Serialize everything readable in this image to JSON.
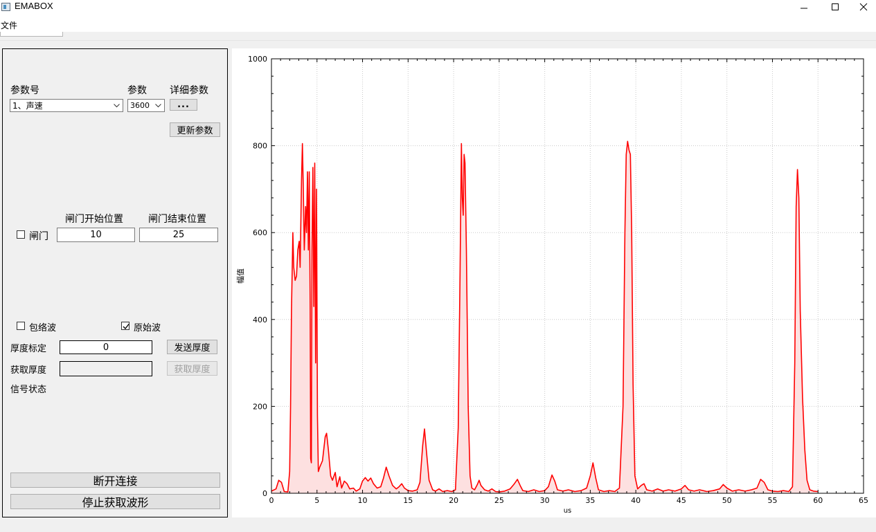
{
  "window": {
    "title": "EMABOX",
    "controls": [
      "minimize-icon",
      "maximize-icon",
      "close-icon"
    ]
  },
  "menu": {
    "file": "文件"
  },
  "params": {
    "param_no_label": "参数号",
    "param_label": "参数",
    "detail_label": "详细参数",
    "param_no_value": "1、声速",
    "param_value": "3600",
    "detail_button": "...",
    "update_button": "更新参数"
  },
  "gate": {
    "checkbox_label": "闸门",
    "checked": false,
    "start_label": "闸门开始位置",
    "end_label": "闸门结束位置",
    "start_value": "10",
    "end_value": "25"
  },
  "wave": {
    "envelope_label": "包络波",
    "envelope_checked": false,
    "raw_label": "原始波",
    "raw_checked": true
  },
  "thickness": {
    "calib_label": "厚度标定",
    "calib_value": "0",
    "send_button": "发送厚度",
    "get_label": "获取厚度",
    "get_value": "",
    "get_button": "获取厚度"
  },
  "signal": {
    "status_label": "信号状态"
  },
  "actions": {
    "disconnect": "断开连接",
    "stop_wave": "停止获取波形"
  },
  "chart_data": {
    "type": "area",
    "xlabel": "us",
    "ylabel": "幅值",
    "xlim": [
      0,
      65
    ],
    "ylim": [
      0,
      1000
    ],
    "x_ticks": [
      0,
      5,
      10,
      15,
      20,
      25,
      30,
      35,
      40,
      45,
      50,
      55,
      60,
      65
    ],
    "y_ticks": [
      0,
      200,
      400,
      600,
      800,
      1000
    ],
    "grid": true,
    "line_color": "#ff0000",
    "fill_color": "#fde0e0",
    "series": [
      {
        "points": [
          [
            0,
            5
          ],
          [
            0.5,
            10
          ],
          [
            0.8,
            30
          ],
          [
            1.1,
            25
          ],
          [
            1.4,
            4
          ],
          [
            1.8,
            3
          ],
          [
            2.0,
            50
          ],
          [
            2.1,
            200
          ],
          [
            2.2,
            420
          ],
          [
            2.35,
            600
          ],
          [
            2.45,
            520
          ],
          [
            2.6,
            490
          ],
          [
            2.75,
            500
          ],
          [
            2.9,
            560
          ],
          [
            3.05,
            580
          ],
          [
            3.15,
            520
          ],
          [
            3.3,
            720
          ],
          [
            3.4,
            805
          ],
          [
            3.5,
            700
          ],
          [
            3.6,
            560
          ],
          [
            3.75,
            660
          ],
          [
            3.85,
            600
          ],
          [
            3.95,
            740
          ],
          [
            4.05,
            560
          ],
          [
            4.15,
            740
          ],
          [
            4.25,
            430
          ],
          [
            4.3,
            80
          ],
          [
            4.38,
            70
          ],
          [
            4.45,
            560
          ],
          [
            4.55,
            750
          ],
          [
            4.65,
            430
          ],
          [
            4.75,
            760
          ],
          [
            4.85,
            300
          ],
          [
            4.95,
            700
          ],
          [
            5.05,
            180
          ],
          [
            5.15,
            50
          ],
          [
            5.3,
            60
          ],
          [
            5.6,
            75
          ],
          [
            5.9,
            130
          ],
          [
            6.05,
            138
          ],
          [
            6.25,
            100
          ],
          [
            6.5,
            40
          ],
          [
            6.7,
            30
          ],
          [
            7.0,
            48
          ],
          [
            7.2,
            15
          ],
          [
            7.5,
            38
          ],
          [
            7.7,
            12
          ],
          [
            8.0,
            28
          ],
          [
            8.3,
            22
          ],
          [
            8.6,
            10
          ],
          [
            9.0,
            12
          ],
          [
            9.3,
            5
          ],
          [
            9.7,
            10
          ],
          [
            10.0,
            28
          ],
          [
            10.3,
            36
          ],
          [
            10.6,
            28
          ],
          [
            10.9,
            35
          ],
          [
            11.2,
            22
          ],
          [
            11.6,
            12
          ],
          [
            12.0,
            15
          ],
          [
            12.3,
            35
          ],
          [
            12.6,
            60
          ],
          [
            12.9,
            40
          ],
          [
            13.3,
            18
          ],
          [
            13.7,
            10
          ],
          [
            14.0,
            15
          ],
          [
            14.3,
            22
          ],
          [
            14.6,
            12
          ],
          [
            15.0,
            6
          ],
          [
            15.5,
            5
          ],
          [
            16.0,
            8
          ],
          [
            16.3,
            25
          ],
          [
            16.6,
            110
          ],
          [
            16.8,
            148
          ],
          [
            17.0,
            100
          ],
          [
            17.3,
            30
          ],
          [
            17.7,
            8
          ],
          [
            18.0,
            5
          ],
          [
            18.4,
            10
          ],
          [
            18.8,
            4
          ],
          [
            19.3,
            6
          ],
          [
            19.8,
            4
          ],
          [
            20.2,
            8
          ],
          [
            20.5,
            150
          ],
          [
            20.7,
            500
          ],
          [
            20.85,
            805
          ],
          [
            20.95,
            680
          ],
          [
            21.05,
            640
          ],
          [
            21.15,
            780
          ],
          [
            21.25,
            760
          ],
          [
            21.4,
            560
          ],
          [
            21.6,
            200
          ],
          [
            21.8,
            40
          ],
          [
            22.0,
            12
          ],
          [
            22.3,
            8
          ],
          [
            22.6,
            20
          ],
          [
            22.8,
            30
          ],
          [
            23.0,
            18
          ],
          [
            23.4,
            8
          ],
          [
            23.8,
            5
          ],
          [
            24.2,
            10
          ],
          [
            24.6,
            4
          ],
          [
            25.0,
            3
          ],
          [
            25.6,
            5
          ],
          [
            26.2,
            10
          ],
          [
            26.6,
            20
          ],
          [
            27.0,
            32
          ],
          [
            27.3,
            18
          ],
          [
            27.6,
            6
          ],
          [
            28.2,
            4
          ],
          [
            28.8,
            8
          ],
          [
            29.4,
            4
          ],
          [
            30.0,
            6
          ],
          [
            30.4,
            15
          ],
          [
            30.8,
            42
          ],
          [
            31.1,
            28
          ],
          [
            31.4,
            8
          ],
          [
            32.0,
            5
          ],
          [
            32.6,
            8
          ],
          [
            33.3,
            4
          ],
          [
            34.0,
            6
          ],
          [
            34.6,
            12
          ],
          [
            35.0,
            40
          ],
          [
            35.3,
            70
          ],
          [
            35.6,
            35
          ],
          [
            35.9,
            8
          ],
          [
            36.5,
            4
          ],
          [
            37.1,
            6
          ],
          [
            37.7,
            4
          ],
          [
            38.2,
            12
          ],
          [
            38.6,
            200
          ],
          [
            38.8,
            600
          ],
          [
            38.95,
            780
          ],
          [
            39.1,
            810
          ],
          [
            39.25,
            790
          ],
          [
            39.4,
            780
          ],
          [
            39.55,
            600
          ],
          [
            39.7,
            250
          ],
          [
            39.9,
            40
          ],
          [
            40.2,
            10
          ],
          [
            40.6,
            18
          ],
          [
            40.9,
            22
          ],
          [
            41.2,
            8
          ],
          [
            41.8,
            5
          ],
          [
            42.4,
            10
          ],
          [
            43.0,
            5
          ],
          [
            43.6,
            8
          ],
          [
            44.3,
            5
          ],
          [
            45.0,
            10
          ],
          [
            45.4,
            18
          ],
          [
            45.8,
            8
          ],
          [
            46.4,
            5
          ],
          [
            47.0,
            8
          ],
          [
            47.8,
            4
          ],
          [
            48.5,
            6
          ],
          [
            49.2,
            10
          ],
          [
            49.6,
            20
          ],
          [
            50.0,
            12
          ],
          [
            50.6,
            5
          ],
          [
            51.3,
            8
          ],
          [
            52.0,
            5
          ],
          [
            52.7,
            8
          ],
          [
            53.3,
            12
          ],
          [
            53.7,
            32
          ],
          [
            54.1,
            25
          ],
          [
            54.5,
            8
          ],
          [
            55.0,
            5
          ],
          [
            55.6,
            4
          ],
          [
            56.2,
            6
          ],
          [
            56.8,
            4
          ],
          [
            57.2,
            15
          ],
          [
            57.45,
            300
          ],
          [
            57.6,
            660
          ],
          [
            57.75,
            745
          ],
          [
            57.9,
            680
          ],
          [
            58.05,
            420
          ],
          [
            58.3,
            220
          ],
          [
            58.55,
            100
          ],
          [
            58.8,
            30
          ],
          [
            59.1,
            8
          ],
          [
            59.5,
            5
          ],
          [
            60.0,
            4
          ]
        ]
      }
    ]
  }
}
